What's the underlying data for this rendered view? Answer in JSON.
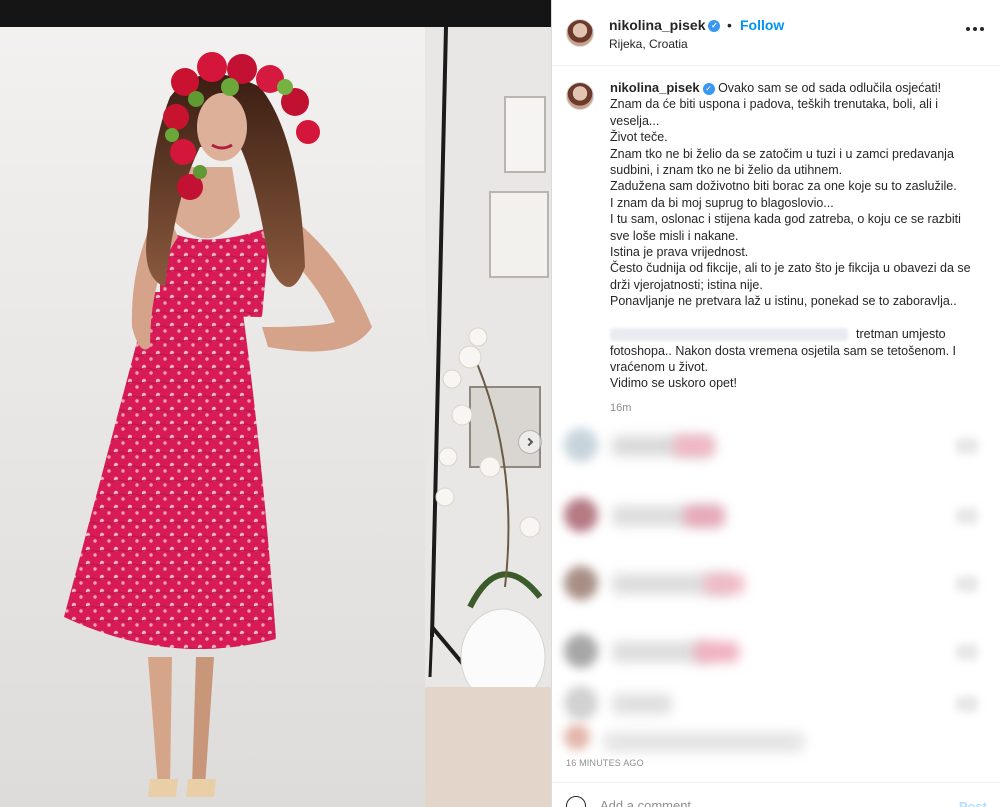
{
  "header": {
    "username": "nikolina_pisek",
    "separator": "•",
    "follow_label": "Follow",
    "location": "Rijeka, Croatia",
    "more_icon": "more-horizontal-icon"
  },
  "caption": {
    "username": "nikolina_pisek",
    "lines": [
      "Ovako sam se od sada odlučila osjećati!",
      "Znam da će biti uspona i padova, teških trenutaka, boli, ali i",
      "veselja...",
      "Život teče.",
      "Znam tko ne bi želio da se zatočim u tuzi i u zamci predavanja",
      "sudbini, i znam tko ne bi želio da utihnem.",
      "Zadužena sam doživotno biti borac za one koje su to zaslužile.",
      "I znam da bi moj suprug to blagoslovio...",
      "I tu sam, oslonac i stijena kada god zatreba, o koju ce se razbiti",
      "sve loše misli i nakane.",
      "Istina je prava vrijednost.",
      "Često čudnija od fikcije, ali to je zato što je fikcija u obavezi da se",
      "drži vjerojatnosti; istina nije.",
      "Ponavljanje ne pretvara laž u istinu, ponekad se to zaboravlja..",
      "",
      "tretman umjesto",
      "fotoshopa.. Nakon dosta vremena osjetila sam se tetošenom. I",
      "vraćenom u život.",
      "Vidimo se uskoro opet!"
    ],
    "relative_time": "16m"
  },
  "timestamp": "16 MINUTES AGO",
  "comment_box": {
    "placeholder": "Add a comment...",
    "post_label": "Post"
  },
  "colors": {
    "accent": "#0095f6",
    "dress": "#d81b56",
    "text": "#262626",
    "muted": "#8e8e8e"
  }
}
